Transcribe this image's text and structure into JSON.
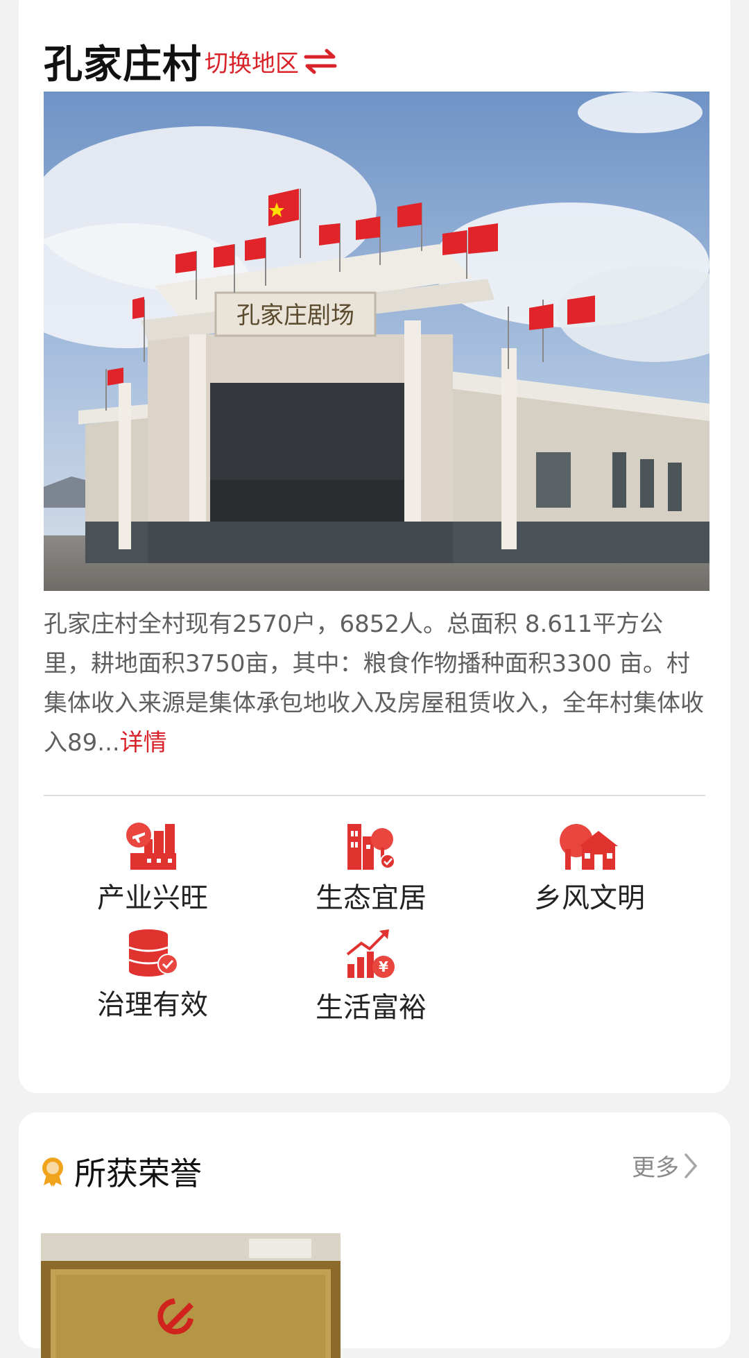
{
  "header": {
    "village_name": "孔家庄村",
    "switch_label": "切换地区"
  },
  "hero": {
    "sign_text": "孔家庄剧场"
  },
  "intro": {
    "text": "孔家庄村全村现有2570户，6852人。总面积 8.611平方公里，耕地面积3750亩，其中：粮食作物播种面积3300 亩。村集体收入来源是集体承包地收入及房屋租赁收入，全年村集体收入89...",
    "detail_label": "详情"
  },
  "features": [
    {
      "label": "产业兴旺",
      "icon": "industry-icon"
    },
    {
      "label": "生态宜居",
      "icon": "eco-living-icon"
    },
    {
      "label": "乡风文明",
      "icon": "rural-civilization-icon"
    },
    {
      "label": "治理有效",
      "icon": "governance-icon"
    },
    {
      "label": "生活富裕",
      "icon": "prosperity-icon"
    }
  ],
  "honors": {
    "title": "所获荣誉",
    "more_label": "更多"
  },
  "colors": {
    "accent_red": "#d9232a",
    "honor_gold": "#f0a41c"
  }
}
